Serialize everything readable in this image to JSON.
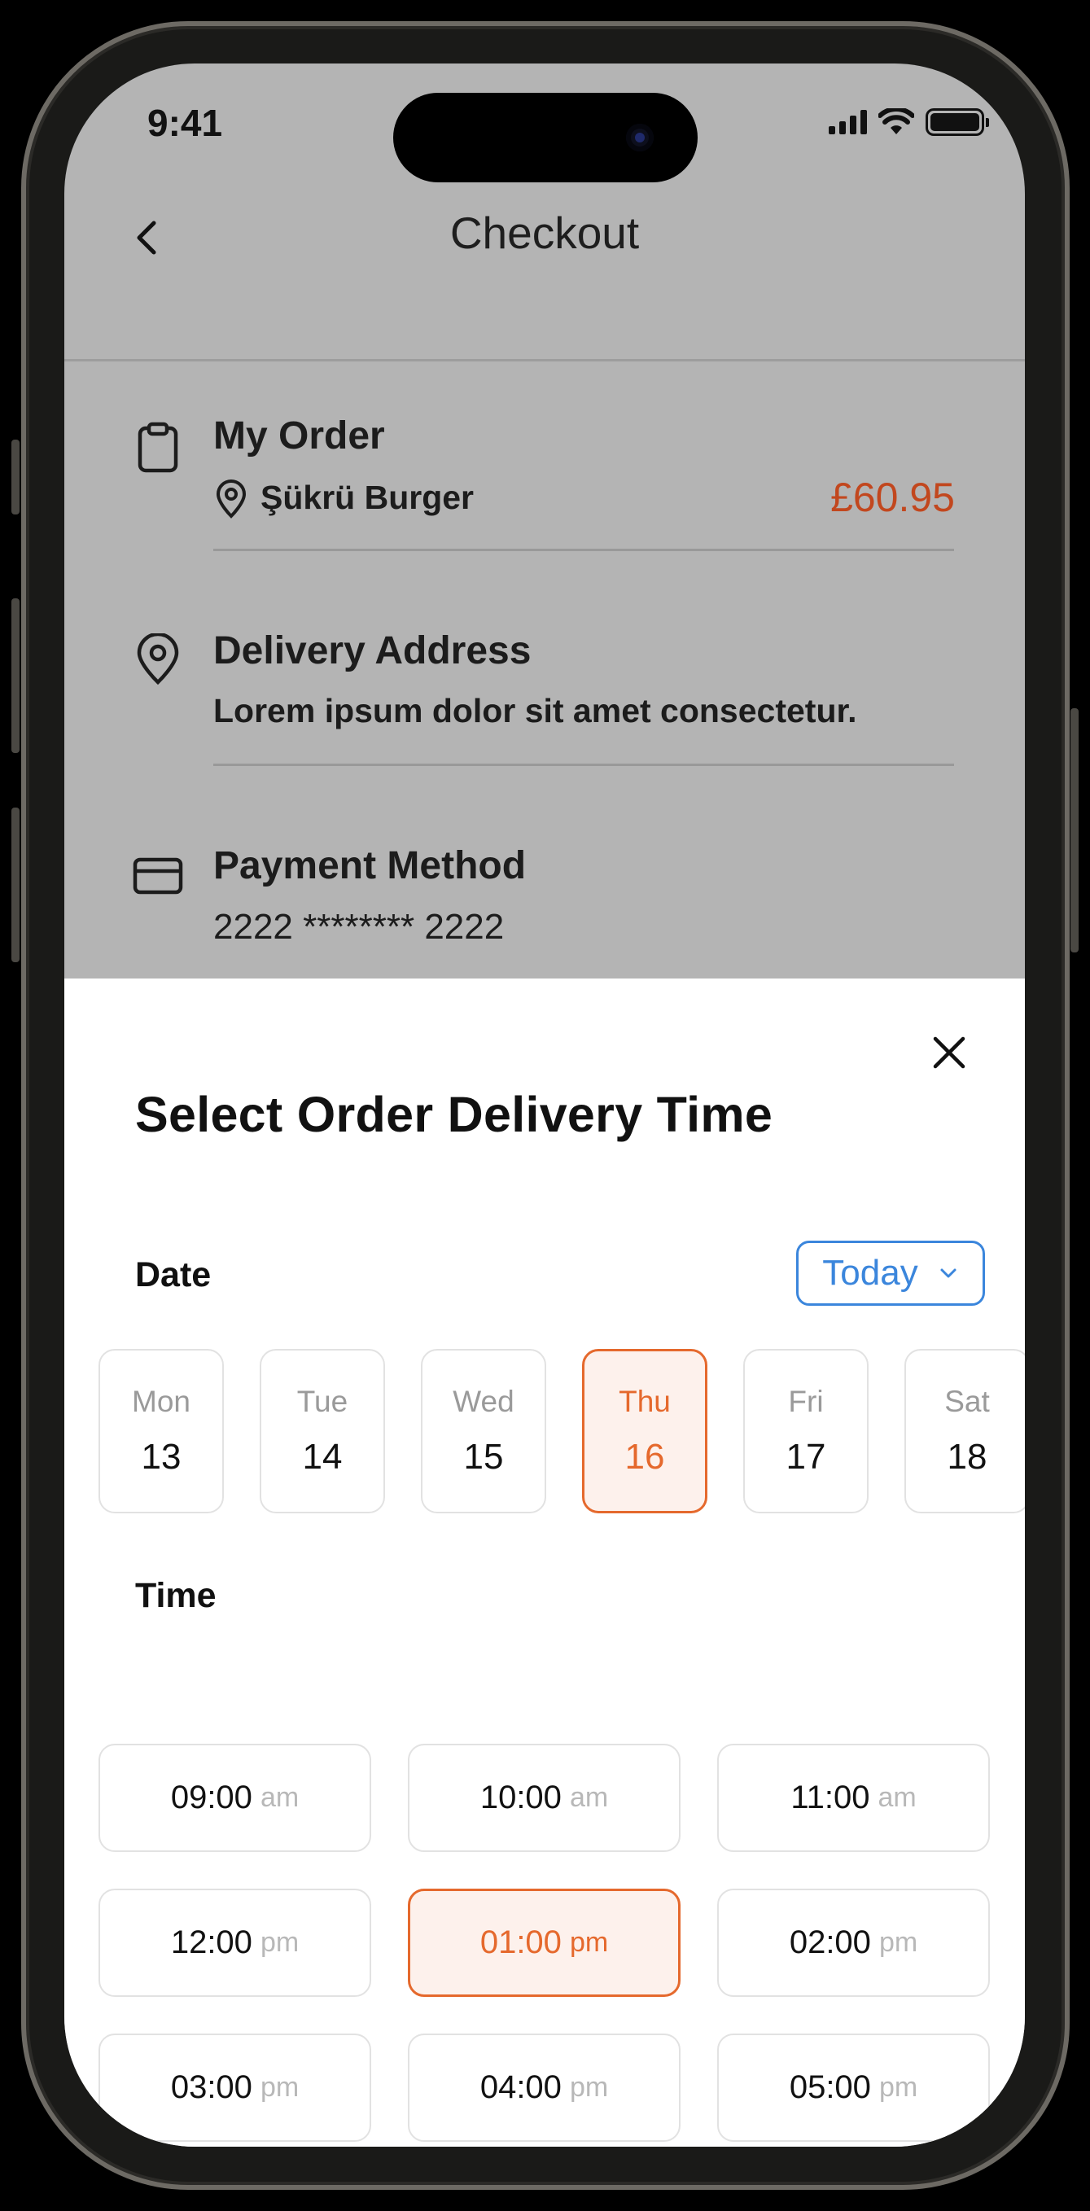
{
  "status_bar": {
    "time": "9:41"
  },
  "header": {
    "title": "Checkout"
  },
  "order": {
    "title": "My Order",
    "restaurant": "Şükrü Burger",
    "price": "£60.95"
  },
  "delivery": {
    "title": "Delivery Address",
    "address": "Lorem ipsum dolor sit amet consectetur."
  },
  "payment": {
    "title": "Payment Method",
    "card": "2222 ******** 2222"
  },
  "sheet": {
    "title": "Select Order Delivery Time",
    "date_label": "Date",
    "date_dropdown": "Today",
    "time_label": "Time"
  },
  "days": [
    {
      "name": "Mon",
      "num": "13",
      "selected": false
    },
    {
      "name": "Tue",
      "num": "14",
      "selected": false
    },
    {
      "name": "Wed",
      "num": "15",
      "selected": false
    },
    {
      "name": "Thu",
      "num": "16",
      "selected": true
    },
    {
      "name": "Fri",
      "num": "17",
      "selected": false
    },
    {
      "name": "Sat",
      "num": "18",
      "selected": false
    }
  ],
  "times": [
    {
      "time": "09:00",
      "period": "am",
      "selected": false
    },
    {
      "time": "10:00",
      "period": "am",
      "selected": false
    },
    {
      "time": "11:00",
      "period": "am",
      "selected": false
    },
    {
      "time": "12:00",
      "period": "pm",
      "selected": false
    },
    {
      "time": "01:00",
      "period": "pm",
      "selected": true
    },
    {
      "time": "02:00",
      "period": "pm",
      "selected": false
    },
    {
      "time": "03:00",
      "period": "pm",
      "selected": false
    },
    {
      "time": "04:00",
      "period": "pm",
      "selected": false
    },
    {
      "time": "05:00",
      "period": "pm",
      "selected": false
    }
  ],
  "colors": {
    "accent": "#e5692d",
    "price": "#c2471e",
    "link": "#3b86dc",
    "overlay": "#b4b4b4"
  },
  "icons": [
    "back-icon",
    "clipboard-icon",
    "location-pin-icon",
    "credit-card-icon",
    "close-icon",
    "chevron-down-icon",
    "signal-icon",
    "wifi-icon",
    "battery-icon"
  ]
}
